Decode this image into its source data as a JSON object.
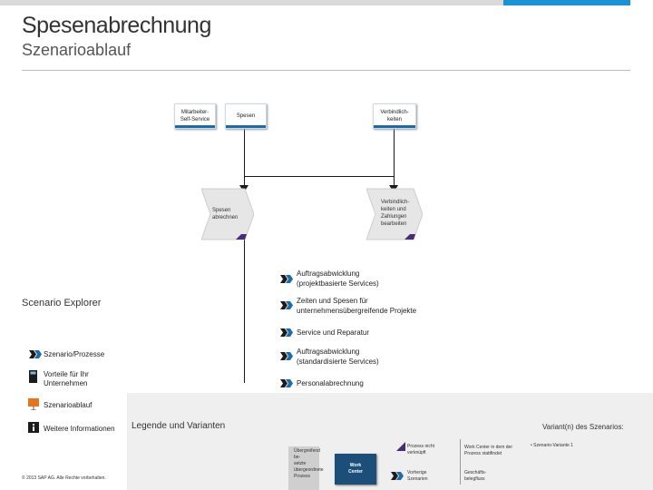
{
  "header": {
    "title": "Spesenabrechnung",
    "subtitle": "Szenarioablauf"
  },
  "lanes": [
    {
      "label": "Mitarbeiter-\nSelf-Service"
    },
    {
      "label": "Spesen"
    },
    {
      "label": "Verbindlich-\nkeiten"
    }
  ],
  "steps": [
    {
      "label": "Spesen\nabrechnen"
    },
    {
      "label": "Verbindlich-\nkeiten und\nZahlungen\nbearbeiten"
    }
  ],
  "links": [
    {
      "label": "Auftragsabwicklung\n(projektbasierte Services)"
    },
    {
      "label": "Zeiten und Spesen für\nunternehmensübergreifende Projekte"
    },
    {
      "label": "Service und Reparatur"
    },
    {
      "label": "Auftragsabwicklung\n(standardisierte Services)"
    },
    {
      "label": "Personalabrechnung"
    }
  ],
  "nav": {
    "explorer": "Scenario Explorer",
    "items": [
      {
        "label": "Szenario/Prozesse"
      },
      {
        "label": "Vorteile für Ihr\nUnternehmen"
      },
      {
        "label": "Szenarioablauf"
      },
      {
        "label": "Weitere Informationen"
      }
    ]
  },
  "legend": {
    "title": "Legende und Varianten",
    "variants_title": "Variant(n) des Szenarios:",
    "items": {
      "external": "Übergreifend be-\nsetzte\nübergeordnete\nProzess",
      "work_center": "Work\nCenter",
      "process_not_used": "Prozess nicht\nverknüpft",
      "previous_scenario": "Vorherige\nSzenarien",
      "work_center_note": "Work Center in dem der\nProzess stattfindet",
      "business_object": "Geschäfts-\nbelegfluss",
      "variant": "• Szenario-Variante 1"
    }
  },
  "footer": {
    "copyright": "© 2013 SAP AG. Alle Rechte vorbehalten."
  },
  "colors": {
    "accent_blue": "#1a93d6",
    "lane_bar": "#1b6ca8",
    "step_corner": "#4b2a7a",
    "nav_orange": "#e8731c",
    "chevron_dark": "#1c1c1c",
    "chevron_blue": "#1b6ca8"
  }
}
